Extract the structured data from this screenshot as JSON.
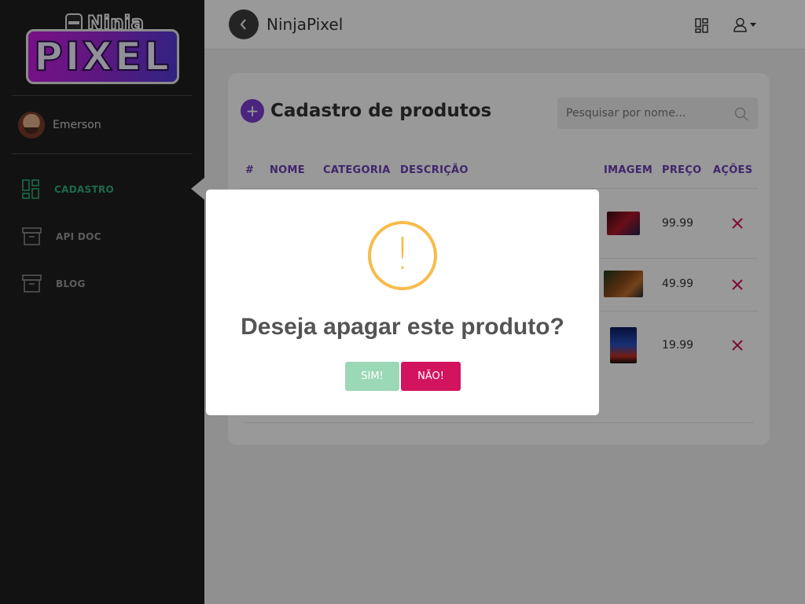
{
  "logo": {
    "top_text": "Ninja",
    "main_text": "PIXEL"
  },
  "user": {
    "name": "Emerson"
  },
  "sidebar": {
    "items": [
      {
        "label": "CADASTRO",
        "icon": "dashboard-icon",
        "active": true
      },
      {
        "label": "API DOC",
        "icon": "archive-icon",
        "active": false
      },
      {
        "label": "BLOG",
        "icon": "archive-icon",
        "active": false
      }
    ]
  },
  "header": {
    "brand": "NinjaPixel",
    "back_icon": "chevron-left-icon",
    "grid_icon": "dashboard-icon",
    "user_icon": "user-icon"
  },
  "card": {
    "title": "Cadastro de produtos",
    "search_placeholder": "Pesquisar por nome...",
    "columns": [
      "#",
      "NOME",
      "CATEGORIA",
      "DESCRIÇÃO",
      "IMAGEM",
      "PREÇO",
      "AÇÕES"
    ],
    "rows": [
      {
        "price": "99.99"
      },
      {
        "price": "49.99"
      },
      {
        "price": "19.99"
      }
    ]
  },
  "modal": {
    "icon": "!",
    "title": "Deseja apagar este produto?",
    "confirm_label": "SIM!",
    "cancel_label": "NÃO!"
  },
  "colors": {
    "accent_purple": "#7b3fd1",
    "active_green": "#2fb17c",
    "warning": "#f8bb4c",
    "confirm": "#9bd8b5",
    "cancel": "#d2135e"
  }
}
